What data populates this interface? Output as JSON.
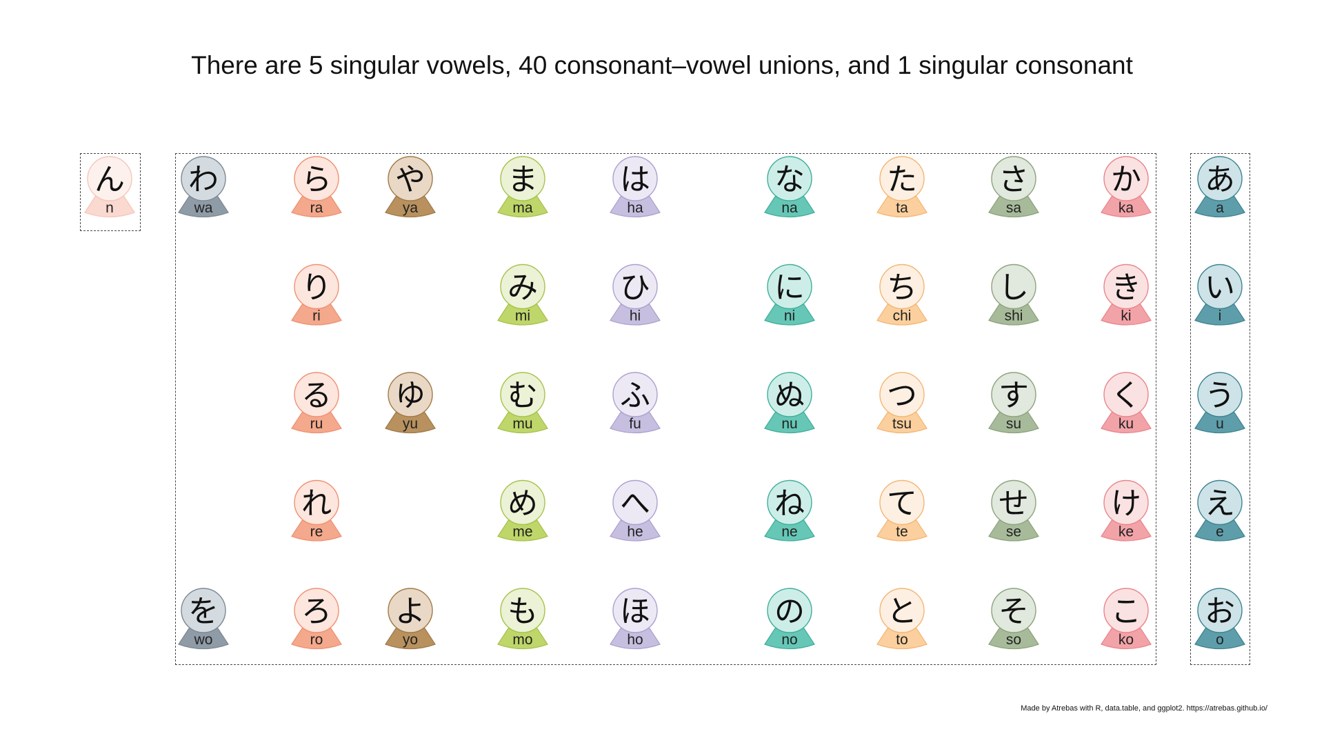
{
  "title": "There are 5 singular vowels, 40 consonant–vowel unions, and 1 singular consonant",
  "credit": "Made by Atrebas with R, data.table, and ggplot2. https://atrebas.github.io/",
  "groups": [
    {
      "id": "n",
      "name": "singular consonant"
    },
    {
      "id": "unions",
      "name": "consonant–vowel unions"
    },
    {
      "id": "vowels",
      "name": "singular vowels"
    }
  ],
  "columns": [
    {
      "id": "n",
      "fill": "#fdf1ed",
      "base": "#f9d9d0",
      "edge": "#f7c5b8",
      "kana": [
        {
          "row": 0,
          "char": "ん",
          "roma": "n"
        }
      ]
    },
    {
      "id": "w",
      "fill": "#d4dbe0",
      "base": "#8f9ba6",
      "edge": "#7d8994",
      "kana": [
        {
          "row": 0,
          "char": "わ",
          "roma": "wa"
        },
        {
          "row": 4,
          "char": "を",
          "roma": "wo"
        }
      ]
    },
    {
      "id": "r",
      "fill": "#fde6dd",
      "base": "#f4a88c",
      "edge": "#ef9174",
      "kana": [
        {
          "row": 0,
          "char": "ら",
          "roma": "ra"
        },
        {
          "row": 1,
          "char": "り",
          "roma": "ri"
        },
        {
          "row": 2,
          "char": "る",
          "roma": "ru"
        },
        {
          "row": 3,
          "char": "れ",
          "roma": "re"
        },
        {
          "row": 4,
          "char": "ろ",
          "roma": "ro"
        }
      ]
    },
    {
      "id": "y",
      "fill": "#ead8c6",
      "base": "#b8915f",
      "edge": "#a07a48",
      "kana": [
        {
          "row": 0,
          "char": "や",
          "roma": "ya"
        },
        {
          "row": 2,
          "char": "ゆ",
          "roma": "yu"
        },
        {
          "row": 4,
          "char": "よ",
          "roma": "yo"
        }
      ]
    },
    {
      "id": "m",
      "fill": "#ecf2d5",
      "base": "#bfd66a",
      "edge": "#a6c24b",
      "kana": [
        {
          "row": 0,
          "char": "ま",
          "roma": "ma"
        },
        {
          "row": 1,
          "char": "み",
          "roma": "mi"
        },
        {
          "row": 2,
          "char": "む",
          "roma": "mu"
        },
        {
          "row": 3,
          "char": "め",
          "roma": "me"
        },
        {
          "row": 4,
          "char": "も",
          "roma": "mo"
        }
      ]
    },
    {
      "id": "h",
      "fill": "#ece9f5",
      "base": "#c7bfdf",
      "edge": "#ad9fcf",
      "kana": [
        {
          "row": 0,
          "char": "は",
          "roma": "ha"
        },
        {
          "row": 1,
          "char": "ひ",
          "roma": "hi"
        },
        {
          "row": 2,
          "char": "ふ",
          "roma": "fu"
        },
        {
          "row": 3,
          "char": "へ",
          "roma": "he"
        },
        {
          "row": 4,
          "char": "ほ",
          "roma": "ho"
        }
      ]
    },
    {
      "id": "na",
      "fill": "#cdeee8",
      "base": "#66c7b6",
      "edge": "#3fae9b",
      "kana": [
        {
          "row": 0,
          "char": "な",
          "roma": "na"
        },
        {
          "row": 1,
          "char": "に",
          "roma": "ni"
        },
        {
          "row": 2,
          "char": "ぬ",
          "roma": "nu"
        },
        {
          "row": 3,
          "char": "ね",
          "roma": "ne"
        },
        {
          "row": 4,
          "char": "の",
          "roma": "no"
        }
      ]
    },
    {
      "id": "t",
      "fill": "#fdf0e2",
      "base": "#fbd09e",
      "edge": "#f5b574",
      "kana": [
        {
          "row": 0,
          "char": "た",
          "roma": "ta"
        },
        {
          "row": 1,
          "char": "ち",
          "roma": "chi"
        },
        {
          "row": 2,
          "char": "つ",
          "roma": "tsu"
        },
        {
          "row": 3,
          "char": "て",
          "roma": "te"
        },
        {
          "row": 4,
          "char": "と",
          "roma": "to"
        }
      ]
    },
    {
      "id": "s",
      "fill": "#e1e8dd",
      "base": "#a7bb9a",
      "edge": "#8ca37d",
      "kana": [
        {
          "row": 0,
          "char": "さ",
          "roma": "sa"
        },
        {
          "row": 1,
          "char": "し",
          "roma": "shi"
        },
        {
          "row": 2,
          "char": "す",
          "roma": "su"
        },
        {
          "row": 3,
          "char": "せ",
          "roma": "se"
        },
        {
          "row": 4,
          "char": "そ",
          "roma": "so"
        }
      ]
    },
    {
      "id": "k",
      "fill": "#fbe2e2",
      "base": "#f2a3a8",
      "edge": "#e9858c",
      "kana": [
        {
          "row": 0,
          "char": "か",
          "roma": "ka"
        },
        {
          "row": 1,
          "char": "き",
          "roma": "ki"
        },
        {
          "row": 2,
          "char": "く",
          "roma": "ku"
        },
        {
          "row": 3,
          "char": "け",
          "roma": "ke"
        },
        {
          "row": 4,
          "char": "こ",
          "roma": "ko"
        }
      ]
    },
    {
      "id": "vowel",
      "fill": "#cde3e8",
      "base": "#5e9eaa",
      "edge": "#3f8390",
      "kana": [
        {
          "row": 0,
          "char": "あ",
          "roma": "a"
        },
        {
          "row": 1,
          "char": "い",
          "roma": "i"
        },
        {
          "row": 2,
          "char": "う",
          "roma": "u"
        },
        {
          "row": 3,
          "char": "え",
          "roma": "e"
        },
        {
          "row": 4,
          "char": "お",
          "roma": "o"
        }
      ]
    }
  ]
}
